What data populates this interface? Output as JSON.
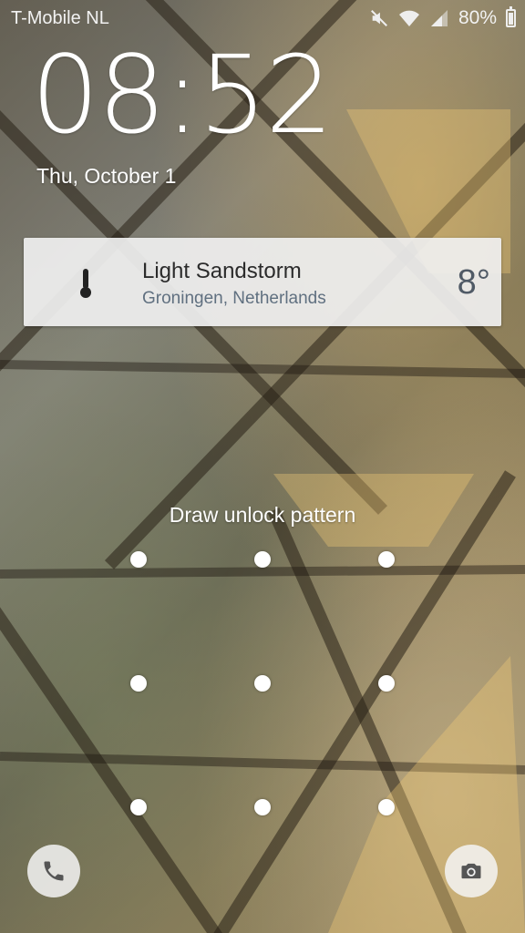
{
  "status_bar": {
    "carrier": "T-Mobile  NL",
    "battery_percent": "80%",
    "battery_level": 0.8,
    "icons": [
      "mute-icon",
      "wifi-icon",
      "signal-icon",
      "battery-icon"
    ]
  },
  "lock_screen": {
    "time": "08:52",
    "date": "Thu, October 1"
  },
  "weather": {
    "icon": "thermometer-icon",
    "condition": "Light Sandstorm",
    "location": "Groningen, Netherlands",
    "temperature": "8°"
  },
  "unlock": {
    "hint": "Draw unlock pattern",
    "grid_rows": 3,
    "grid_cols": 3
  },
  "shortcuts": {
    "left": "phone-icon",
    "right": "camera-icon"
  }
}
